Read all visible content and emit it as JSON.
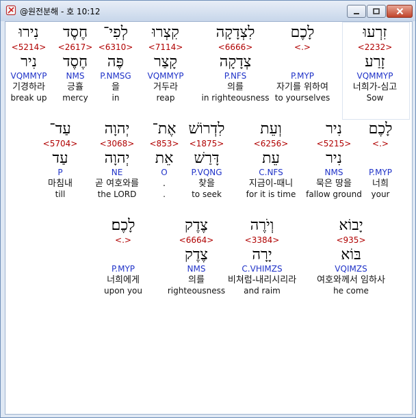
{
  "window": {
    "title": "@원전분해 - 호 10:12",
    "buttons": {
      "minimize": "minimize",
      "maximize": "maximize",
      "close": "close"
    }
  },
  "rows": [
    [
      {
        "heb": "זִרְעוּ",
        "strong": "<2232>",
        "root": "זָרַע",
        "morph": "VQMMYP",
        "kor": "너희가-심고",
        "eng": "Sow"
      },
      {
        "heb": "לָכֶם",
        "strong": "<.>",
        "root": "",
        "morph": "P.MYP",
        "kor": "자기를 위하여",
        "eng": "to yourselves"
      },
      {
        "heb": "לִצְדָקָה",
        "strong": "<6666>",
        "root": "צְדָקָה",
        "morph": "P.NFS",
        "kor": "의를",
        "eng": "in righteousness"
      },
      {
        "heb": "קִצְרוּ",
        "strong": "<7114>",
        "root": "קָצַר",
        "morph": "VQMMYP",
        "kor": "거두라",
        "eng": "reap"
      },
      {
        "heb": "לְפִי־",
        "strong": "<6310>",
        "root": "פֶּה",
        "morph": "P.NMSG",
        "kor": "을",
        "eng": "in"
      },
      {
        "heb": "חֶסֶד",
        "strong": "<2617>",
        "root": "חֶסֶד",
        "morph": "NMS",
        "kor": "긍휼",
        "eng": "mercy"
      },
      {
        "heb": "נִירוּ",
        "strong": "<5214>",
        "root": "נִיר",
        "morph": "VQMMYP",
        "kor": "기경하라",
        "eng": "break up"
      }
    ],
    [
      {
        "heb": "לָכֶם",
        "strong": "<.>",
        "root": "",
        "morph": "P.MYP",
        "kor": "너희",
        "eng": "your"
      },
      {
        "heb": "נִיר",
        "strong": "<5215>",
        "root": "נִיר",
        "morph": "NMS",
        "kor": "묵은 땅을",
        "eng": "fallow ground"
      },
      {
        "heb": "וְעֵת",
        "strong": "<6256>",
        "root": "עֵת",
        "morph": "C.NFS",
        "kor": "지금이-때니",
        "eng": "for it is time"
      },
      {
        "heb": "לִדְרוֹשׁ",
        "strong": "<1875>",
        "root": "דָּרַשׁ",
        "morph": "P.VQNG",
        "kor": "찾을",
        "eng": "to seek"
      },
      {
        "heb": "אֶת־",
        "strong": "<853>",
        "root": "אֵת",
        "morph": "O",
        "kor": ".",
        "eng": "."
      },
      {
        "heb": "יְהוָה",
        "strong": "<3068>",
        "root": "יְהוָה",
        "morph": "NE",
        "kor": "곧 여호와를",
        "eng": "the LORD"
      },
      {
        "heb": "עַד־",
        "strong": "<5704>",
        "root": "עַד",
        "morph": "P",
        "kor": "마침내",
        "eng": "till"
      }
    ],
    [
      {
        "heb": "יָבוֹא",
        "strong": "<935>",
        "root": "בּוֹא",
        "morph": "VQIMZS",
        "kor": "여호와께서 임하사",
        "eng": "he come"
      },
      {
        "heb": "וְיֹרֶה",
        "strong": "<3384>",
        "root": "יָרָה",
        "morph": "C.VHIMZS",
        "kor": "비쳐럼-내리시리라",
        "eng": "and raim"
      },
      {
        "heb": "צֶדֶק",
        "strong": "<6664>",
        "root": "צֶדֶק",
        "morph": "NMS",
        "kor": "의를",
        "eng": "righteousness"
      },
      {
        "heb": "לָכֶם׃",
        "strong": "<.>",
        "root": "",
        "morph": "P.MYP",
        "kor": "너희에게",
        "eng": "upon you"
      }
    ]
  ]
}
